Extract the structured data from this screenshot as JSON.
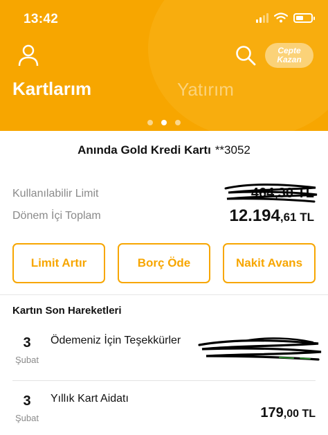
{
  "status_bar": {
    "time": "13:42"
  },
  "header": {
    "cepte_button": {
      "line1": "Cepte",
      "line2": "Kazan"
    },
    "tabs": [
      {
        "label": "Kartlarım",
        "active": true
      },
      {
        "label": "Yatırım",
        "active": false
      }
    ],
    "page_dots": {
      "count": 3,
      "active_index": 1
    },
    "colors": {
      "background": "#f7a600",
      "text": "#ffffff"
    }
  },
  "card": {
    "name": "Anında Gold Kredi Kartı",
    "number": "**3052",
    "available_limit": {
      "label": "Kullanılabilir Limit",
      "value": "464,30 TL"
    },
    "period_total": {
      "label": "Dönem İçi Toplam",
      "value_main": "12.194",
      "value_decimal": ",61 TL"
    }
  },
  "actions": [
    {
      "label": "Limit Artır"
    },
    {
      "label": "Borç Öde"
    },
    {
      "label": "Nakit Avans"
    }
  ],
  "transactions": {
    "title": "Kartın Son Hareketleri",
    "items": [
      {
        "day": "3",
        "month": "Şubat",
        "description": "Ödemeniz İçin Teşekkürler",
        "amount_main": "",
        "amount_decimal": "",
        "redacted": true
      },
      {
        "day": "3",
        "month": "Şubat",
        "description": "Yıllık Kart Aidatı",
        "amount_main": "179",
        "amount_decimal": ",00 TL",
        "redacted": false
      }
    ]
  },
  "icons": [
    "user-icon",
    "search-icon",
    "wifi-icon",
    "signal-icon",
    "battery-icon"
  ],
  "accent_color": "#f7a600"
}
